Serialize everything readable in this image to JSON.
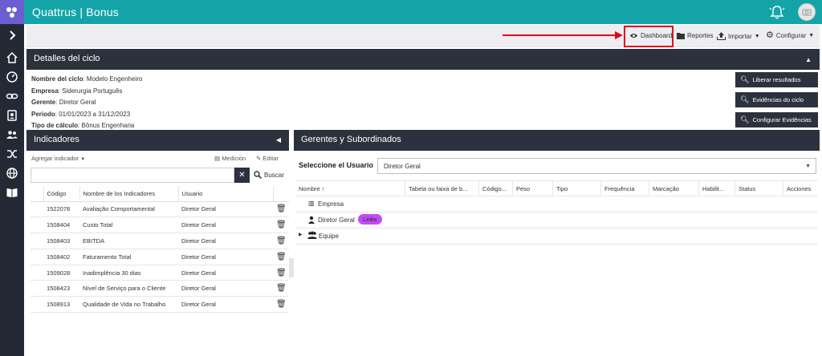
{
  "app": {
    "title": "Quattrus | Bonus",
    "brand_color": "#14a4a8",
    "dark_color": "#2c323d"
  },
  "sidebar": {
    "items": [
      {
        "icon": "chevron-right-icon"
      },
      {
        "icon": "home-icon"
      },
      {
        "icon": "gauge-icon"
      },
      {
        "icon": "link-icon"
      },
      {
        "icon": "badge-icon"
      },
      {
        "icon": "users-icon"
      },
      {
        "icon": "shuffle-icon"
      },
      {
        "icon": "globe-icon"
      },
      {
        "icon": "book-icon"
      }
    ]
  },
  "toolbar": {
    "dashboard": "Dashboard",
    "reportes": "Reportes",
    "importar": "Importar",
    "configurar": "Configurar"
  },
  "details": {
    "title": "Detalles del ciclo",
    "fields": [
      {
        "label": "Nombre del ciclo",
        "value": "Modelo Engenheiro"
      },
      {
        "label": "Empresa",
        "value": "Siderurgia Português"
      },
      {
        "label": "Gerente",
        "value": "Diretor Geral"
      },
      {
        "label": "Periodo",
        "value": "01/01/2023 a 31/12/2023"
      },
      {
        "label": "Tipo de cálculo",
        "value": "Bônus Engenharia"
      }
    ],
    "buttons": [
      "Liberar resultados",
      "Evidências do ciclo",
      "Configurar Evidências"
    ]
  },
  "indicadores": {
    "title": "Indicadores",
    "add_label": "Agregar indicador",
    "medicion": "Medición",
    "editar": "Editar",
    "search_button": "Buscar",
    "search_value": "",
    "columns": [
      "Código",
      "Nombre de los Indicadores",
      "Usuario"
    ],
    "rows": [
      [
        "1522078",
        "Avaliação Comportamental",
        "Diretor Geral"
      ],
      [
        "1508404",
        "Custo Total",
        "Diretor Geral"
      ],
      [
        "1508403",
        "EBITDA",
        "Diretor Geral"
      ],
      [
        "1508402",
        "Faturamento Total",
        "Diretor Geral"
      ],
      [
        "1509028",
        "Inadimplência 30 dias",
        "Diretor Geral"
      ],
      [
        "1508423",
        "Nível de Serviço para o Cliente",
        "Diretor Geral"
      ],
      [
        "1508913",
        "Qualidade de Vida no Trabalho",
        "Diretor Geral"
      ]
    ]
  },
  "gerentes": {
    "title": "Gerentes y Subordinados",
    "select_label": "Seleccione el Usuario",
    "selected_user": "Diretor Geral",
    "columns": [
      "Nombre",
      "Tabela ou faixa de b...",
      "Códigо...",
      "Peso",
      "Tipo",
      "Frequência",
      "Marcação",
      "Habilit...",
      "Status",
      "Acciones"
    ],
    "tree": [
      {
        "label": "Empresa",
        "icon": "building-icon"
      },
      {
        "label": "Diretor Geral",
        "icon": "person-icon",
        "badge": "Links"
      },
      {
        "label": "Equipe",
        "icon": "group-icon"
      }
    ]
  }
}
